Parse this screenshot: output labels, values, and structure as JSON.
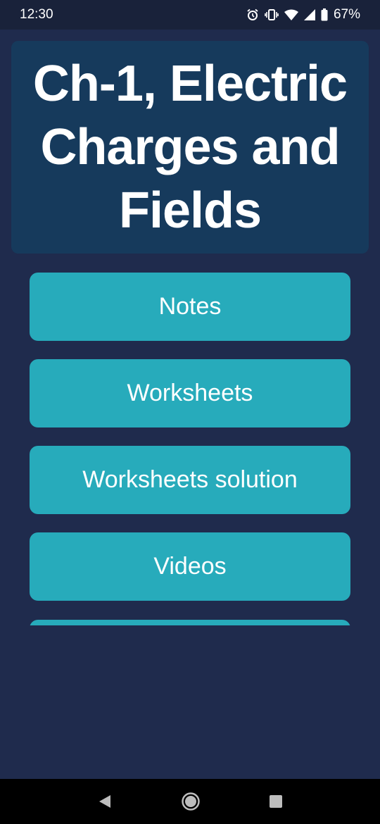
{
  "status_bar": {
    "time": "12:30",
    "battery": "67%"
  },
  "title": "Ch-1, Electric Charges and Fields",
  "menu": [
    {
      "label": "Notes"
    },
    {
      "label": "Worksheets"
    },
    {
      "label": "Worksheets solution"
    },
    {
      "label": "Videos"
    }
  ],
  "colors": {
    "background": "#1f2b4d",
    "title_card": "#163a5c",
    "button": "#27abbb"
  },
  "icons": {
    "status": [
      "alarm-icon",
      "vibrate-icon",
      "wifi-icon",
      "signal-icon",
      "battery-icon"
    ],
    "nav": [
      "back-icon",
      "home-icon",
      "recents-icon"
    ]
  }
}
